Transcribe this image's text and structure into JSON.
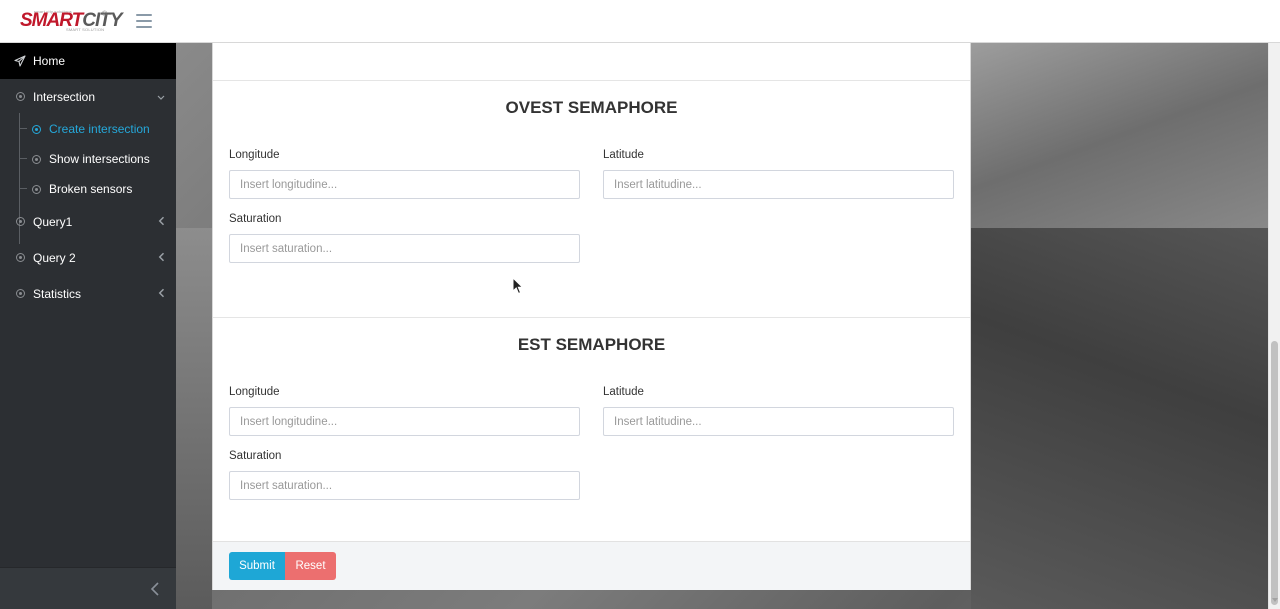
{
  "header": {
    "logo_main_a": "SMART",
    "logo_main_b": "CITY",
    "logo_tm": "®",
    "logo_top": "smart city solutions",
    "logo_sub": "SMART SOLUTION"
  },
  "sidebar": {
    "home": {
      "label": "Home",
      "icon": "send-icon"
    },
    "intersection": {
      "label": "Intersection",
      "icon": "circle-dot-icon",
      "state": "expanded"
    },
    "sub_items": [
      {
        "label": "Create intersection",
        "active": true
      },
      {
        "label": "Show intersections",
        "active": false
      },
      {
        "label": "Broken sensors",
        "active": false
      }
    ],
    "query1": {
      "label": "Query1"
    },
    "query2": {
      "label": "Query 2"
    },
    "statistics": {
      "label": "Statistics"
    },
    "accent_color": "#25a8da"
  },
  "form": {
    "ovest": {
      "title": "OVEST SEMAPHORE",
      "longitude_label": "Longitude",
      "longitude_placeholder": "Insert longitudine...",
      "latitude_label": "Latitude",
      "latitude_placeholder": "Insert latitudine...",
      "saturation_label": "Saturation",
      "saturation_placeholder": "Insert saturation..."
    },
    "est": {
      "title": "EST SEMAPHORE",
      "longitude_label": "Longitude",
      "longitude_placeholder": "Insert longitudine...",
      "latitude_label": "Latitude",
      "latitude_placeholder": "Insert latitudine...",
      "saturation_label": "Saturation",
      "saturation_placeholder": "Insert saturation..."
    },
    "submit_label": "Submit",
    "reset_label": "Reset",
    "submit_color": "#1ea7d6",
    "reset_color": "#ec6f6f"
  }
}
